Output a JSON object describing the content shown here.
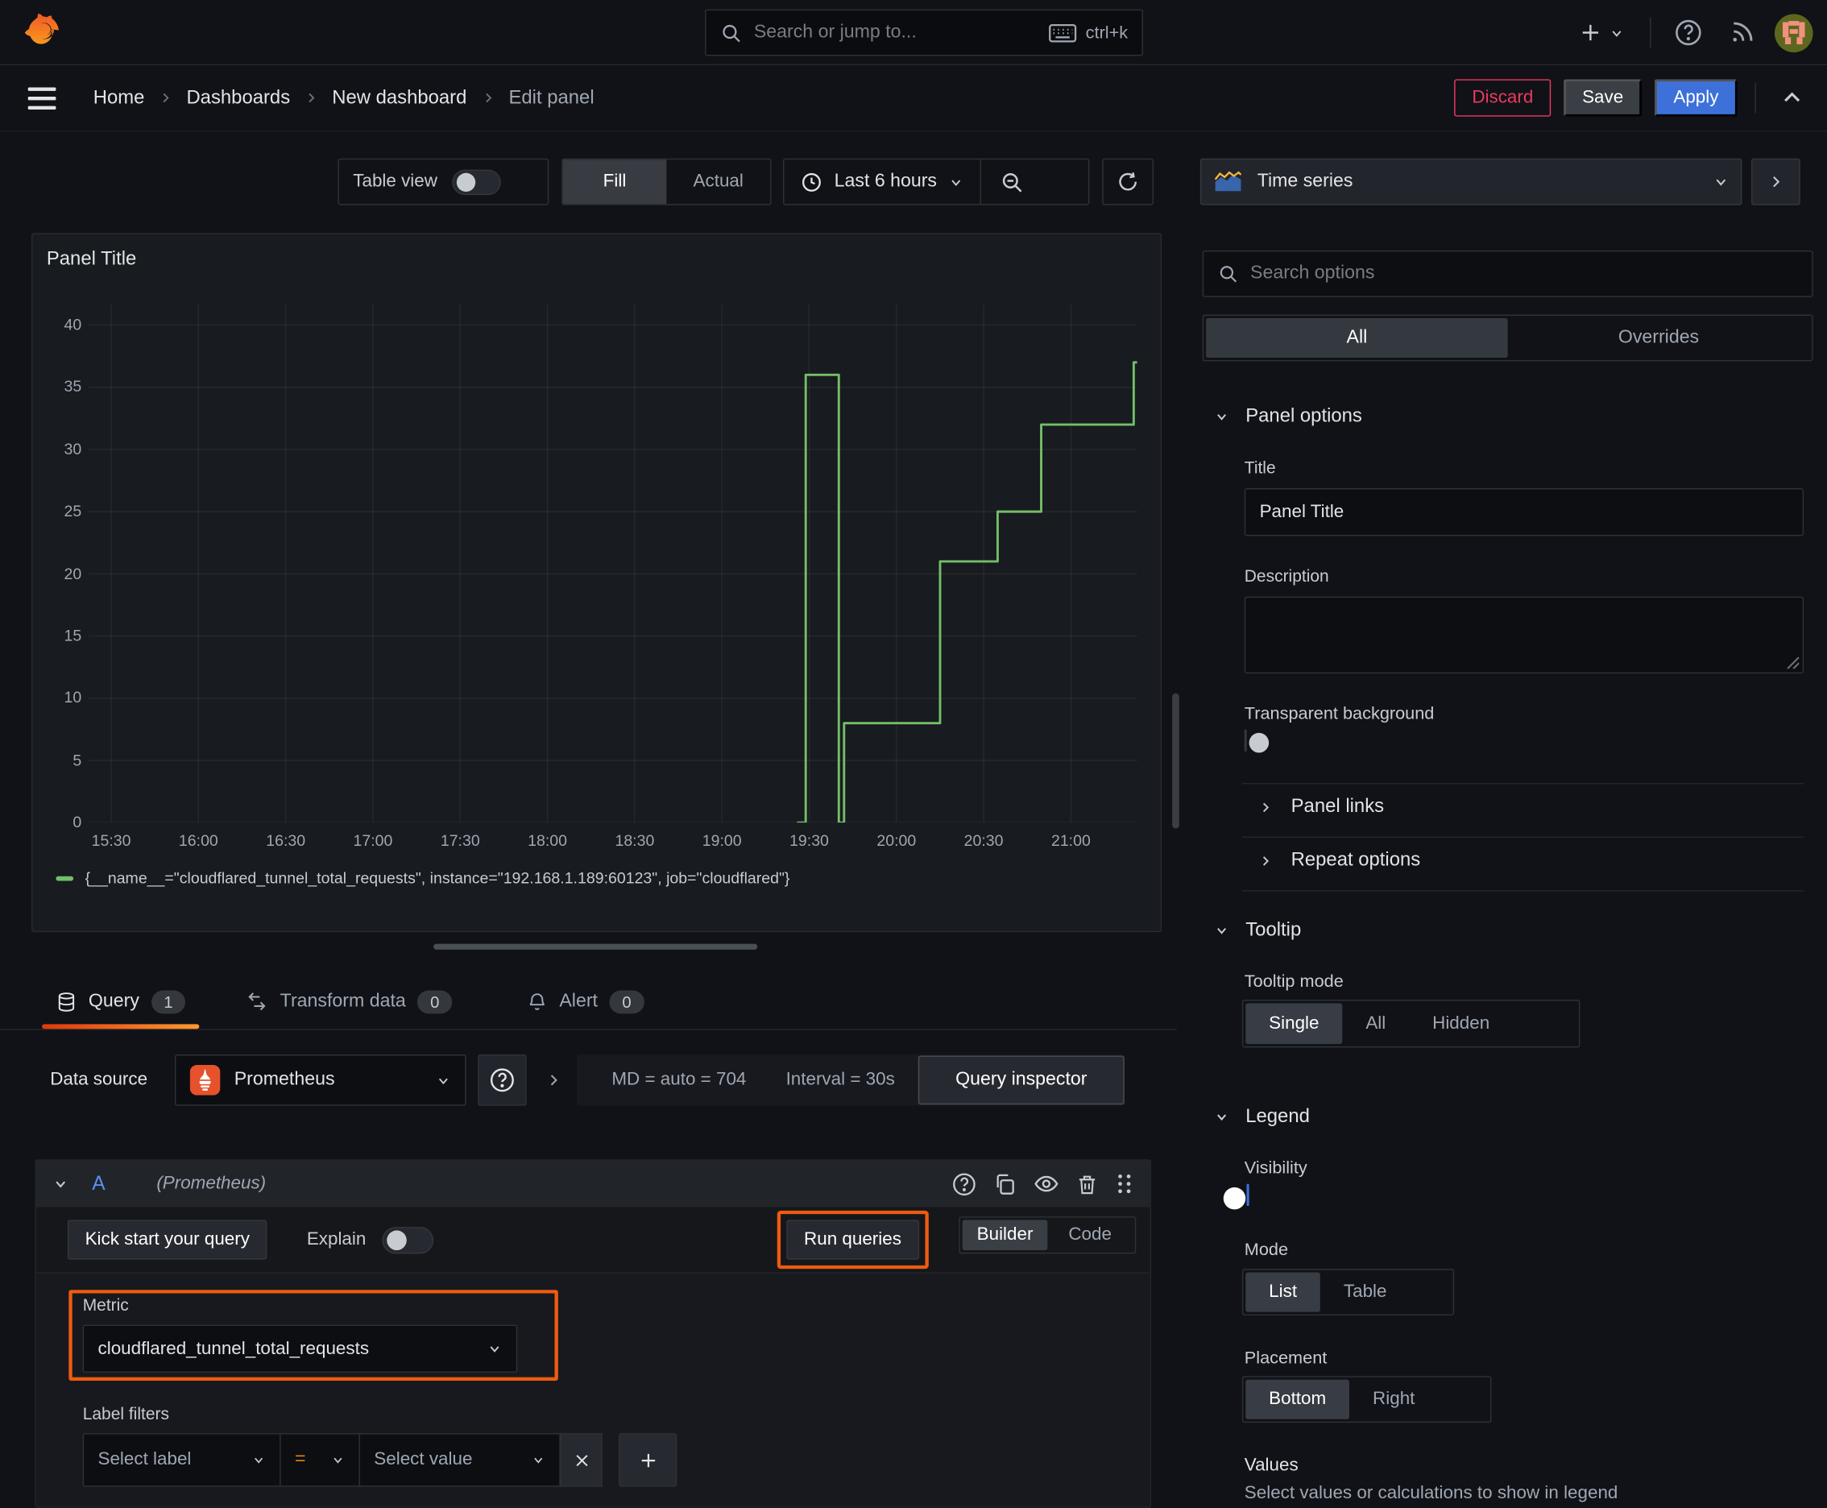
{
  "topbar": {
    "search_placeholder": "Search or jump to...",
    "search_shortcut": "ctrl+k"
  },
  "breadcrumb": {
    "items": [
      "Home",
      "Dashboards",
      "New dashboard",
      "Edit panel"
    ]
  },
  "header_actions": {
    "discard": "Discard",
    "save": "Save",
    "apply": "Apply"
  },
  "canvas_toolbar": {
    "table_view": "Table view",
    "fill": "Fill",
    "actual": "Actual",
    "time_range": "Last 6 hours"
  },
  "viz_picker": {
    "current": "Time series"
  },
  "panel": {
    "title": "Panel Title"
  },
  "chart_data": {
    "type": "line",
    "title": "Panel Title",
    "x_ticks": [
      "15:30",
      "16:00",
      "16:30",
      "17:00",
      "17:30",
      "18:00",
      "18:30",
      "19:00",
      "19:30",
      "20:00",
      "20:30",
      "21:00"
    ],
    "x_range_hours": [
      15.37,
      21.38
    ],
    "y_ticks": [
      0,
      5,
      10,
      15,
      20,
      25,
      30,
      35,
      40
    ],
    "ylim": [
      0,
      40
    ],
    "grid": true,
    "legend_position": "bottom",
    "series": [
      {
        "name": "{__name__=\"cloudflared_tunnel_total_requests\", instance=\"192.168.1.189:60123\", job=\"cloudflared\"}",
        "color": "#73bf69",
        "points_time_value": [
          [
            19.43,
            0
          ],
          [
            19.48,
            0
          ],
          [
            19.48,
            36
          ],
          [
            19.67,
            36
          ],
          [
            19.67,
            0
          ],
          [
            19.7,
            0
          ],
          [
            19.7,
            8
          ],
          [
            20.25,
            8
          ],
          [
            20.25,
            21
          ],
          [
            20.58,
            21
          ],
          [
            20.58,
            25
          ],
          [
            20.83,
            25
          ],
          [
            20.83,
            32
          ],
          [
            21.36,
            32
          ],
          [
            21.36,
            37
          ],
          [
            21.38,
            37
          ]
        ]
      }
    ]
  },
  "query_pane": {
    "tabs": [
      {
        "label": "Query",
        "count": "1"
      },
      {
        "label": "Transform data",
        "count": "0"
      },
      {
        "label": "Alert",
        "count": "0"
      }
    ],
    "active_tab": "Query",
    "datasource_label": "Data source",
    "datasource_name": "Prometheus",
    "max_data_points": "MD = auto = 704",
    "interval": "Interval = 30s",
    "query_inspector": "Query inspector",
    "ref_id": "A",
    "ref_hint": "(Prometheus)",
    "kick_start": "Kick start your query",
    "explain_label": "Explain",
    "run_queries": "Run queries",
    "editor_modes": [
      "Builder",
      "Code"
    ],
    "active_editor_mode": "Builder",
    "metric_label": "Metric",
    "metric_value": "cloudflared_tunnel_total_requests",
    "label_filters_label": "Label filters",
    "select_label_placeholder": "Select label",
    "operator": "=",
    "select_value_placeholder": "Select value"
  },
  "options_pane": {
    "search_placeholder": "Search options",
    "filter_tabs": {
      "all": "All",
      "overrides": "Overrides",
      "active": "All"
    },
    "panel_options": {
      "header": "Panel options",
      "title_label": "Title",
      "title_value": "Panel Title",
      "description_label": "Description",
      "description_value": "",
      "transparent_label": "Transparent background",
      "transparent_on": false
    },
    "panel_links_header": "Panel links",
    "repeat_options_header": "Repeat options",
    "tooltip": {
      "header": "Tooltip",
      "mode_label": "Tooltip mode",
      "modes": [
        "Single",
        "All",
        "Hidden"
      ],
      "active_mode": "Single"
    },
    "legend": {
      "header": "Legend",
      "visibility_label": "Visibility",
      "visibility_on": true,
      "mode_label": "Mode",
      "modes": [
        "List",
        "Table"
      ],
      "active_mode": "List",
      "placement_label": "Placement",
      "placements": [
        "Bottom",
        "Right"
      ],
      "active_placement": "Bottom",
      "values_label": "Values",
      "values_hint": "Select values or calculations to show in legend"
    }
  },
  "colors": {
    "highlight_orange": "#ee5b0e",
    "series_green": "#73bf69",
    "apply_blue": "#3d71d9",
    "toggle_blue": "#3b73d9",
    "discard_red": "#eb3a60"
  }
}
